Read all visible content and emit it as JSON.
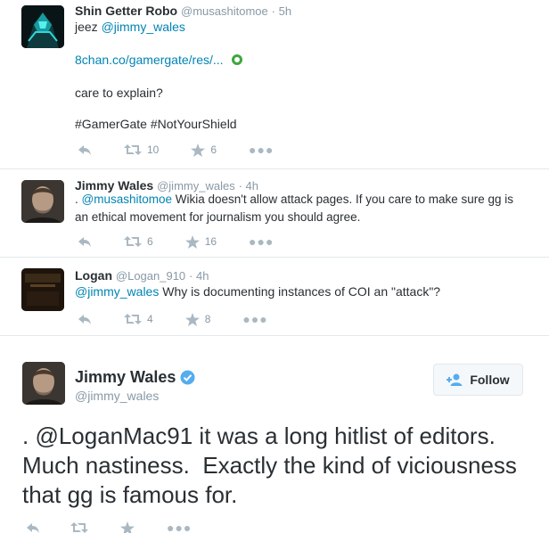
{
  "tweets": [
    {
      "name": "Shin Getter Robo",
      "handle": "@musashitomoe",
      "time": "5h",
      "mention": "@jimmy_wales",
      "prefix": "jeez ",
      "link": "8chan.co/gamergate/res/...",
      "line2": "care to explain?",
      "hashtags": "#GamerGate #NotYourShield",
      "retweets": "10",
      "favorites": "6"
    },
    {
      "name": "Jimmy Wales",
      "handle": "@jimmy_wales",
      "time": "4h",
      "prefix": ". ",
      "mention": "@musashitomoe",
      "text_rest": " Wikia doesn't allow attack pages. If you care to make sure gg is an ethical movement for journalism you should agree.",
      "retweets": "6",
      "favorites": "16"
    },
    {
      "name": "Logan",
      "handle": "@Logan_910",
      "time": "4h",
      "mention": "@jimmy_wales",
      "text_rest": " Why is documenting instances of COI an \"attack\"?",
      "retweets": "4",
      "favorites": "8"
    }
  ],
  "main_tweet": {
    "name": "Jimmy Wales",
    "handle": "@jimmy_wales",
    "follow_label": "Follow",
    "text_prefix": ". ",
    "mention": "@LoganMac91",
    "text_rest": " it was a long hitlist of editors. Much nastiness.  Exactly the kind of viciousness that gg is famous for."
  },
  "colors": {
    "link": "#0084b4",
    "verified": "#55acee",
    "action_icon": "#aab8c2",
    "border": "#e1e8ed"
  },
  "icons": [
    "reply-icon",
    "retweet-icon",
    "favorite-icon",
    "more-icon",
    "verified-badge-icon",
    "follow-person-icon",
    "link-preview-icon"
  ]
}
